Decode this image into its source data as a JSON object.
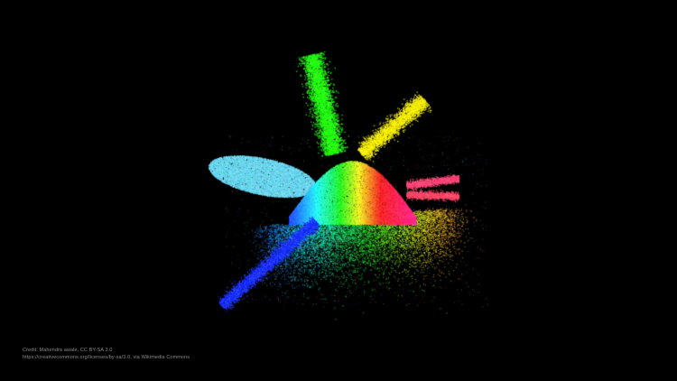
{
  "image": {
    "background": "#000000",
    "subject": "3D point cloud of colors (color gamut visualization)",
    "palette": {
      "blue": "#2a3cff",
      "cyan": "#5ee6f0",
      "green": "#28e016",
      "yellow": "#d8d21a",
      "red": "#ff2a4a",
      "magenta": "#ff2a8c"
    }
  },
  "credit": {
    "line1": "Credit: Mahendra awale, CC BY-SA 3.0",
    "line2": "https://creativecommons.org/licenses/by-sa/3.0, via Wikimedia Commons"
  }
}
